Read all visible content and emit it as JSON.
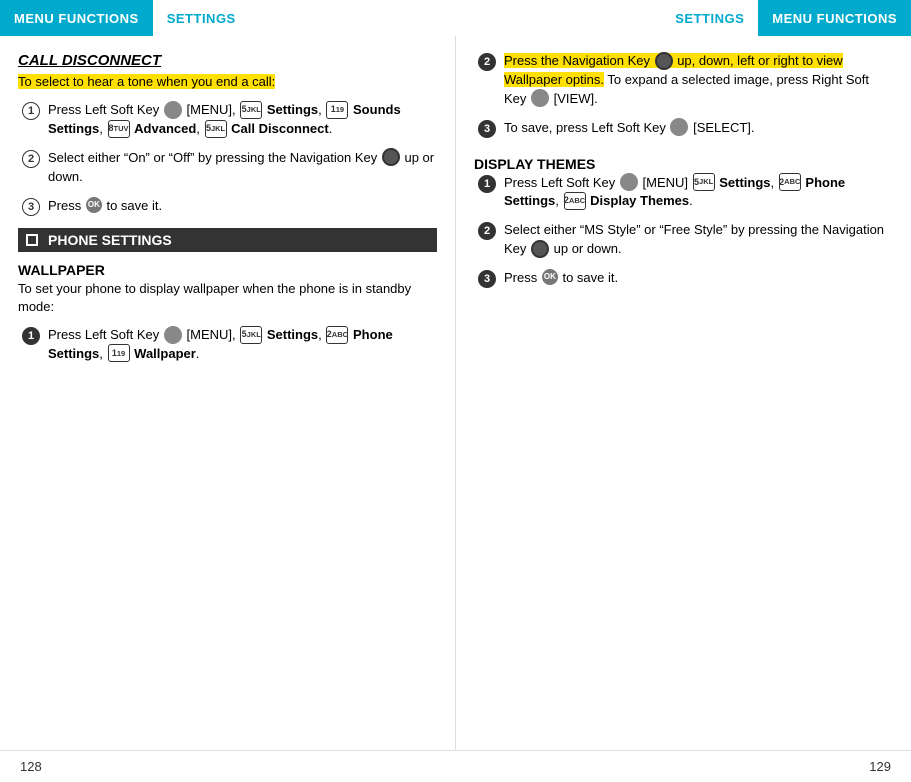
{
  "header": {
    "left_menu_label": "MENU FUNCTIONS",
    "left_settings_label": "SETTINGS",
    "right_settings_label": "SETTINGS",
    "right_menu_label": "MENU FUNCTIONS"
  },
  "left_page": {
    "section_title": "CALL DISCONNECT",
    "intro_highlighted": "To select to hear a tone when you end a call:",
    "steps": [
      {
        "num": "1",
        "filled": false,
        "text_parts": [
          {
            "type": "text",
            "content": "Press Left Soft Key "
          },
          {
            "type": "icon_soft"
          },
          {
            "type": "text",
            "content": " [MENU], "
          },
          {
            "type": "icon_num",
            "content": "5 JKL"
          },
          {
            "type": "text",
            "content": " "
          },
          {
            "type": "bold",
            "content": "Settings"
          },
          {
            "type": "text",
            "content": ", "
          },
          {
            "type": "icon_num",
            "content": "1 19"
          },
          {
            "type": "text",
            "content": " "
          },
          {
            "type": "bold",
            "content": "Sounds Settings"
          },
          {
            "type": "text",
            "content": ", "
          },
          {
            "type": "icon_num",
            "content": "8 TUV"
          },
          {
            "type": "text",
            "content": " "
          },
          {
            "type": "bold",
            "content": "Advanced"
          },
          {
            "type": "text",
            "content": ", "
          },
          {
            "type": "icon_num",
            "content": "5 JKL"
          },
          {
            "type": "text",
            "content": " "
          },
          {
            "type": "bold",
            "content": "Call Disconnect"
          },
          {
            "type": "text",
            "content": "."
          }
        ]
      },
      {
        "num": "2",
        "filled": false,
        "text_parts": [
          {
            "type": "text",
            "content": "Select either “On” or “Off” by pressing the Navigation Key "
          },
          {
            "type": "icon_nav"
          },
          {
            "type": "text",
            "content": " up or down."
          }
        ]
      },
      {
        "num": "3",
        "filled": false,
        "text_parts": [
          {
            "type": "text",
            "content": "Press "
          },
          {
            "type": "icon_ok"
          },
          {
            "type": "text",
            "content": " to save it."
          }
        ]
      }
    ],
    "phone_settings_label": "PHONE SETTINGS",
    "wallpaper_title": "WALLPAPER",
    "wallpaper_intro": "To set your phone to display wallpaper when the phone is in standby mode:",
    "wallpaper_steps": [
      {
        "num": "1",
        "filled": true,
        "text_parts": [
          {
            "type": "text",
            "content": "Press Left Soft Key "
          },
          {
            "type": "icon_soft"
          },
          {
            "type": "text",
            "content": " [MENU], "
          },
          {
            "type": "icon_num",
            "content": "5 JKL"
          },
          {
            "type": "text",
            "content": " "
          },
          {
            "type": "bold",
            "content": "Settings"
          },
          {
            "type": "text",
            "content": ", "
          },
          {
            "type": "icon_num",
            "content": "2 ABC"
          },
          {
            "type": "text",
            "content": " "
          },
          {
            "type": "bold",
            "content": "Phone Settings"
          },
          {
            "type": "text",
            "content": ", "
          },
          {
            "type": "icon_num",
            "content": "1 19"
          },
          {
            "type": "text",
            "content": " "
          },
          {
            "type": "bold",
            "content": "Wallpaper"
          },
          {
            "type": "text",
            "content": "."
          }
        ]
      }
    ],
    "page_number": "128"
  },
  "right_page": {
    "steps": [
      {
        "num": "2",
        "filled": true,
        "highlighted": true,
        "text_before_highlight": "",
        "highlight_text": "Press the Navigation Key",
        "text_after_highlight": " up, down, left or right to view Wallpaper optins.",
        "extra_text": " To expand a selected image, press Right Soft Key ",
        "extra_icon": "icon_soft",
        "extra_end": " [VIEW]."
      },
      {
        "num": "3",
        "filled": true,
        "text_parts": [
          {
            "type": "text",
            "content": "To save, press Left Soft Key "
          },
          {
            "type": "icon_soft"
          },
          {
            "type": "text",
            "content": " [SELECT]."
          }
        ]
      }
    ],
    "display_themes_title": "DISPLAY THEMES",
    "display_steps": [
      {
        "num": "1",
        "filled": true,
        "text_parts": [
          {
            "type": "text",
            "content": "Press Left Soft Key "
          },
          {
            "type": "icon_soft"
          },
          {
            "type": "text",
            "content": " [MENU] "
          },
          {
            "type": "icon_num",
            "content": "5 JKL"
          },
          {
            "type": "text",
            "content": " "
          },
          {
            "type": "bold",
            "content": "Settings"
          },
          {
            "type": "text",
            "content": ", "
          },
          {
            "type": "icon_num",
            "content": "2 ABC"
          },
          {
            "type": "text",
            "content": " "
          },
          {
            "type": "bold",
            "content": "Phone Settings"
          },
          {
            "type": "text",
            "content": ", "
          },
          {
            "type": "icon_num",
            "content": "2 ABC"
          },
          {
            "type": "text",
            "content": " "
          },
          {
            "type": "bold",
            "content": "Display Themes"
          },
          {
            "type": "text",
            "content": "."
          }
        ]
      },
      {
        "num": "2",
        "filled": true,
        "text_parts": [
          {
            "type": "text",
            "content": "Select either “MS Style” or “Free Style” by pressing the Navigation Key "
          },
          {
            "type": "icon_nav"
          },
          {
            "type": "text",
            "content": " up or down."
          }
        ]
      },
      {
        "num": "3",
        "filled": true,
        "text_parts": [
          {
            "type": "text",
            "content": "Press "
          },
          {
            "type": "icon_ok"
          },
          {
            "type": "text",
            "content": " to save it."
          }
        ]
      }
    ],
    "page_number": "129"
  }
}
